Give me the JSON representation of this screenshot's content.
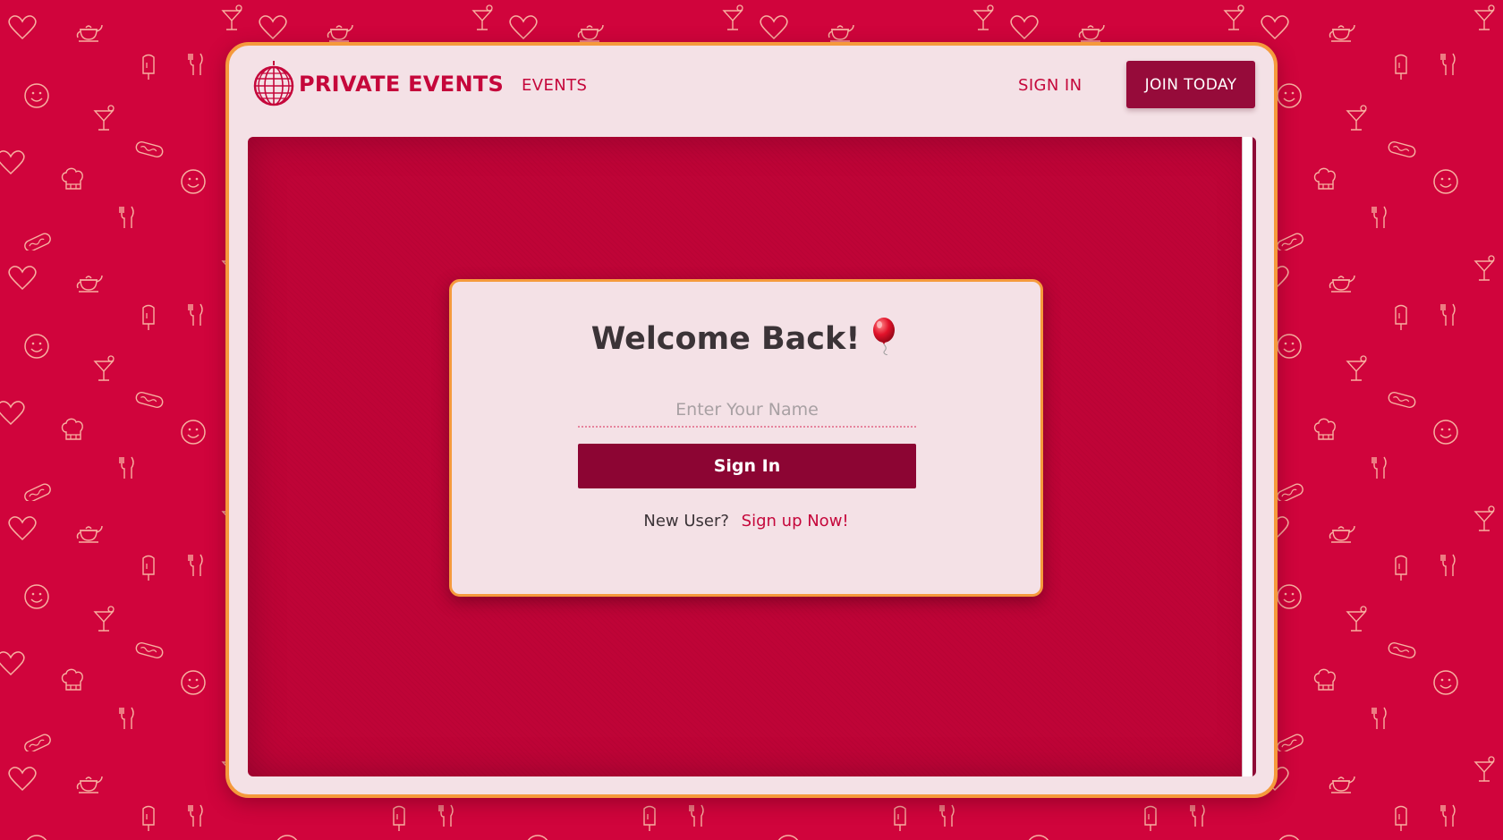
{
  "theme": {
    "page_background": "#d0043c",
    "pattern_stroke": "#f7b0a0",
    "frame_background": "#f4e1e6",
    "frame_border": "#f59a3c",
    "brand_color": "#c5073b",
    "primary_button": "#8c0533",
    "panel_background": "#bf0437"
  },
  "background_icons": [
    "heart-icon",
    "teapot-icon",
    "cocktail-icon",
    "chef-hat-icon",
    "fork-knife-icon",
    "popsicle-icon",
    "hotdog-icon",
    "smiley-icon"
  ],
  "navbar": {
    "brand_name": "PRIVATE EVENTS",
    "brand_logo": "disco-ball-icon",
    "events_link": "EVENTS",
    "signin_link": "SIGN IN",
    "join_button": "JOIN TODAY"
  },
  "login_card": {
    "title": "Welcome Back!",
    "title_icon": "balloon-icon",
    "name_placeholder": "Enter Your Name",
    "name_value": "",
    "signin_button": "Sign In",
    "new_user_prompt": "New User?",
    "signup_link": "Sign up Now!"
  }
}
